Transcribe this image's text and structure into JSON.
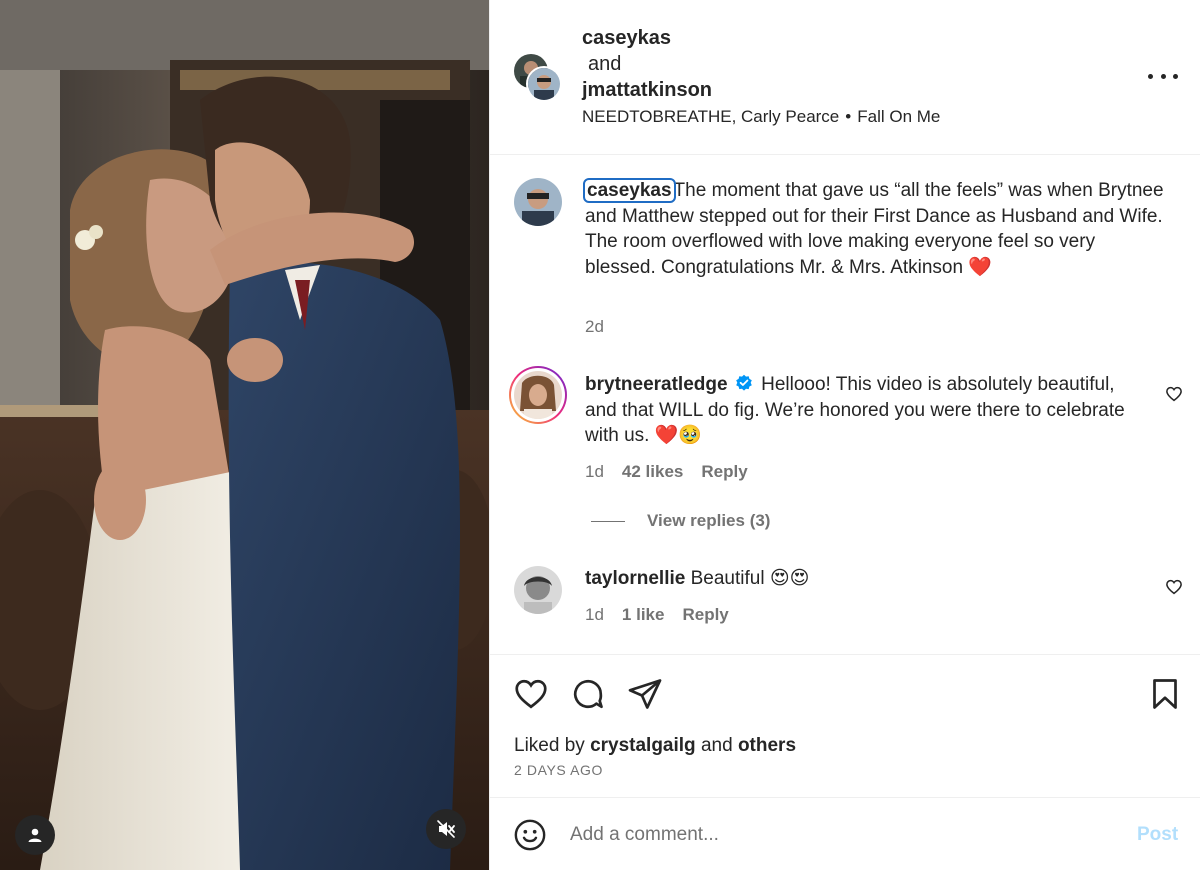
{
  "media": {
    "tag_icon": "person-icon",
    "mute_icon": "speaker-muted-icon"
  },
  "header": {
    "user1": "caseykas",
    "and_text": "and",
    "user2": "jmattatkinson",
    "audio_artists": "NEEDTOBREATHE, Carly Pearce",
    "audio_separator": "•",
    "audio_track": "Fall On Me",
    "more_icon": "more-horizontal-icon"
  },
  "caption": {
    "username": "caseykas",
    "text": "The moment that gave us “all the feels” was when Brytnee and Matthew stepped out for their First Dance as Husband and Wife. The room overflowed with love making everyone feel so very blessed. Congratulations Mr. & Mrs. Atkinson ❤️",
    "time": "2d"
  },
  "comments": [
    {
      "username": "brytneeratledge",
      "verified": true,
      "text": "Hellooo! This video is absolutely beautiful, and that WILL do fig. We’re honored you were there to celebrate with us. ❤️🥹",
      "time": "1d",
      "likes": "42 likes",
      "reply": "Reply",
      "view_replies": "View replies (3)"
    },
    {
      "username": "taylornellie",
      "verified": false,
      "text": "Beautiful 😍😍",
      "time": "1d",
      "likes": "1 like",
      "reply": "Reply"
    }
  ],
  "actions": {
    "like_icon": "heart-icon",
    "comment_icon": "comment-bubble-icon",
    "share_icon": "paper-plane-icon",
    "save_icon": "bookmark-icon",
    "liked_by_prefix": "Liked by",
    "liked_by_user": "crystalgailg",
    "liked_by_and": "and",
    "liked_by_others": "others",
    "time_ago": "2 DAYS AGO"
  },
  "comment_box": {
    "emoji_icon": "smiley-icon",
    "placeholder": "Add a comment...",
    "post_label": "Post"
  },
  "colors": {
    "text": "#262626",
    "secondary_text": "#737373",
    "border": "#efefef",
    "post_disabled": "#b2dffc",
    "verified": "#0095f6",
    "focus_ring": "#1f6cc4",
    "heart_red": "#ed4956"
  }
}
